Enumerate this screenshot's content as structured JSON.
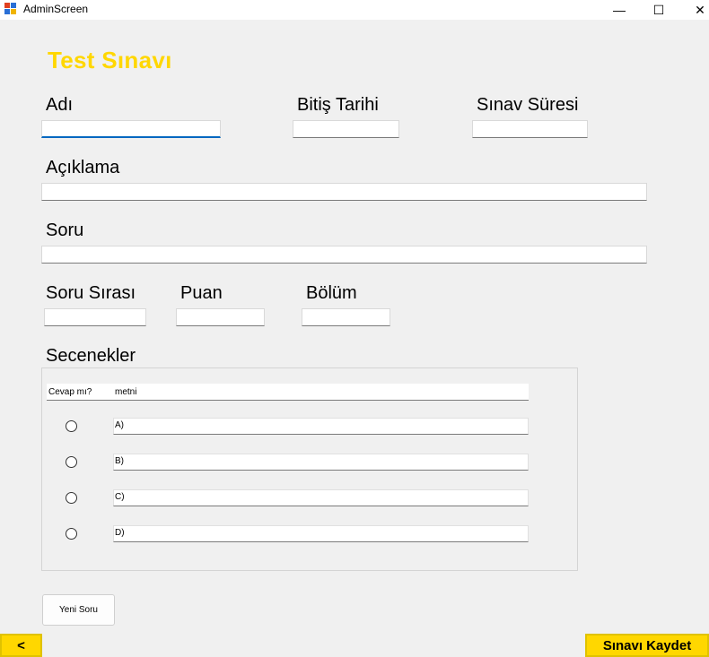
{
  "window": {
    "title": "AdminScreen",
    "controls": {
      "minimize": "—",
      "maximize": "☐",
      "close": "✕"
    }
  },
  "form": {
    "heading": "Test Sınavı",
    "labels": {
      "name": "Adı",
      "end_date": "Bitiş Tarihi",
      "duration": "Sınav Süresi",
      "description": "Açıklama",
      "question": "Soru",
      "question_order": "Soru Sırası",
      "points": "Puan",
      "section": "Bölüm",
      "options": "Secenekler"
    },
    "values": {
      "name": "",
      "end_date": "",
      "duration": "",
      "description": "",
      "question": "",
      "question_order": "",
      "points": "",
      "section": ""
    }
  },
  "options_group": {
    "header": {
      "is_answer": "Cevap mı?",
      "text": "metni"
    },
    "items": [
      {
        "label": "A)",
        "selected": false
      },
      {
        "label": "B)",
        "selected": false
      },
      {
        "label": "C)",
        "selected": false
      },
      {
        "label": "D)",
        "selected": false
      }
    ]
  },
  "buttons": {
    "new_question": "Yeni Soru",
    "back": "<",
    "save_exam": "Sınavı Kaydet"
  },
  "colors": {
    "accent": "#ffd700",
    "focus": "#0067c0",
    "background": "#f0f0f0"
  }
}
